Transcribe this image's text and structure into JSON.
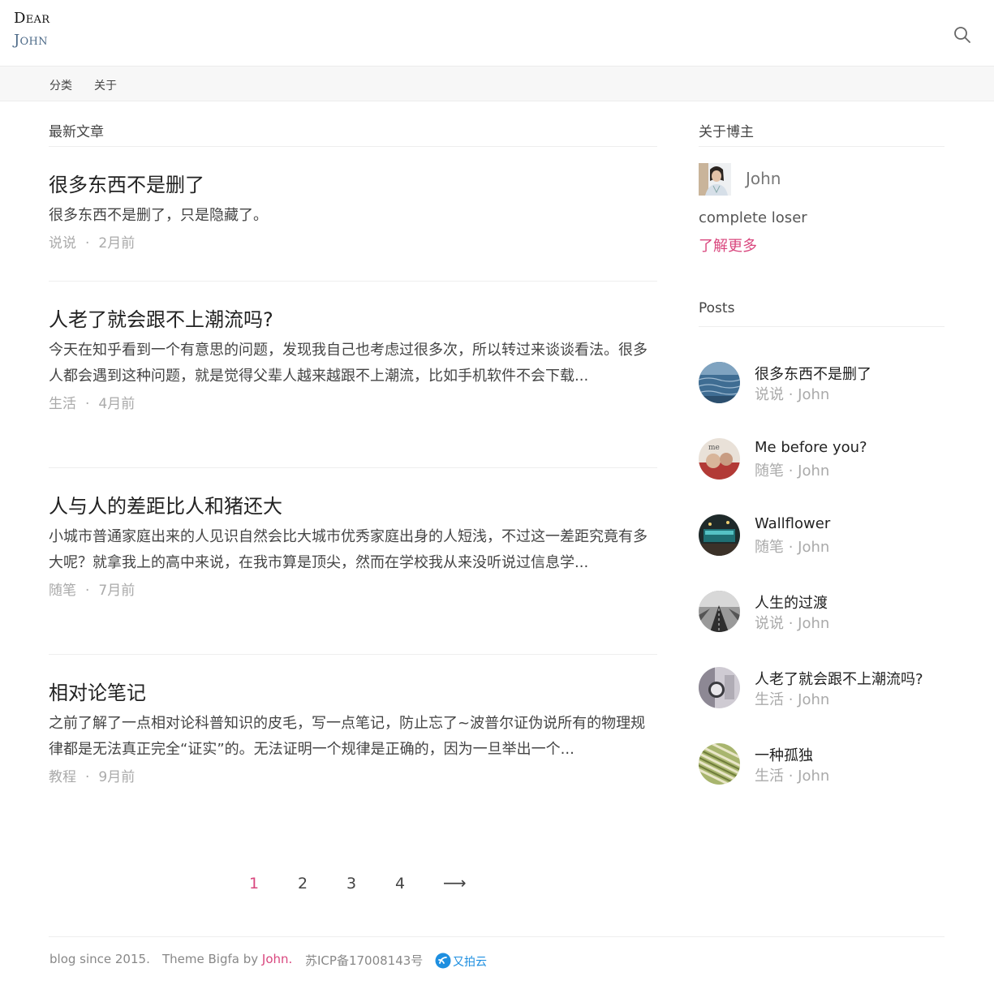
{
  "header": {
    "logo_line1": "Dear",
    "logo_line2": "John"
  },
  "nav": {
    "items": [
      "分类",
      "关于"
    ]
  },
  "main": {
    "section_title": "最新文章",
    "posts": [
      {
        "title": "很多东西不是删了",
        "excerpt": "很多东西不是删了，只是隐藏了。",
        "category": "说说",
        "time": "2月前"
      },
      {
        "title": "人老了就会跟不上潮流吗?",
        "excerpt": "今天在知乎看到一个有意思的问题，发现我自己也考虑过很多次，所以转过来谈谈看法。很多人都会遇到这种问题，就是觉得父辈人越来越跟不上潮流，比如手机软件不会下载...",
        "category": "生活",
        "time": "4月前"
      },
      {
        "title": "人与人的差距比人和猪还大",
        "excerpt": "小城市普通家庭出来的人见识自然会比大城市优秀家庭出身的人短浅，不过这一差距究竟有多大呢？就拿我上的高中来说，在我市算是顶尖，然而在学校我从来没听说过信息学...",
        "category": "随笔",
        "time": "7月前"
      },
      {
        "title": "相对论笔记",
        "excerpt": "之前了解了一点相对论科普知识的皮毛，写一点笔记，防止忘了~波普尔证伪说所有的物理规律都是无法真正完全“证实”的。无法证明一个规律是正确的，因为一旦举出一个...",
        "category": "教程",
        "time": "9月前"
      }
    ],
    "meta_separator": "·"
  },
  "pagination": {
    "pages": [
      "1",
      "2",
      "3",
      "4"
    ],
    "current": "1",
    "next": "⟶"
  },
  "sidebar": {
    "about_title": "关于博主",
    "author_name": "John",
    "bio": "complete loser",
    "more_link": "了解更多",
    "posts_title": "Posts",
    "posts": [
      {
        "title": "很多东西不是删了",
        "meta": "说说 · John"
      },
      {
        "title": "Me before you?",
        "meta": "随笔 · John"
      },
      {
        "title": "Wallflower",
        "meta": "随笔 · John"
      },
      {
        "title": "人生的过渡",
        "meta": "说说 · John"
      },
      {
        "title": "人老了就会跟不上潮流吗?",
        "meta": "生活 · John"
      },
      {
        "title": "一种孤独",
        "meta": "生活 · John"
      }
    ]
  },
  "footer": {
    "since": "blog since 2015.",
    "theme_prefix": "Theme Bigfa by ",
    "theme_author": "John.",
    "icp": "苏ICP备17008143号",
    "cdn": "又拍云"
  },
  "colors": {
    "accent": "#d9477e",
    "cdn": "#1e8fe0",
    "muted": "#aaaaaa"
  },
  "icons": {
    "search": "search-icon",
    "next": "arrow-right-icon",
    "cdn": "upyun-logo-icon"
  }
}
